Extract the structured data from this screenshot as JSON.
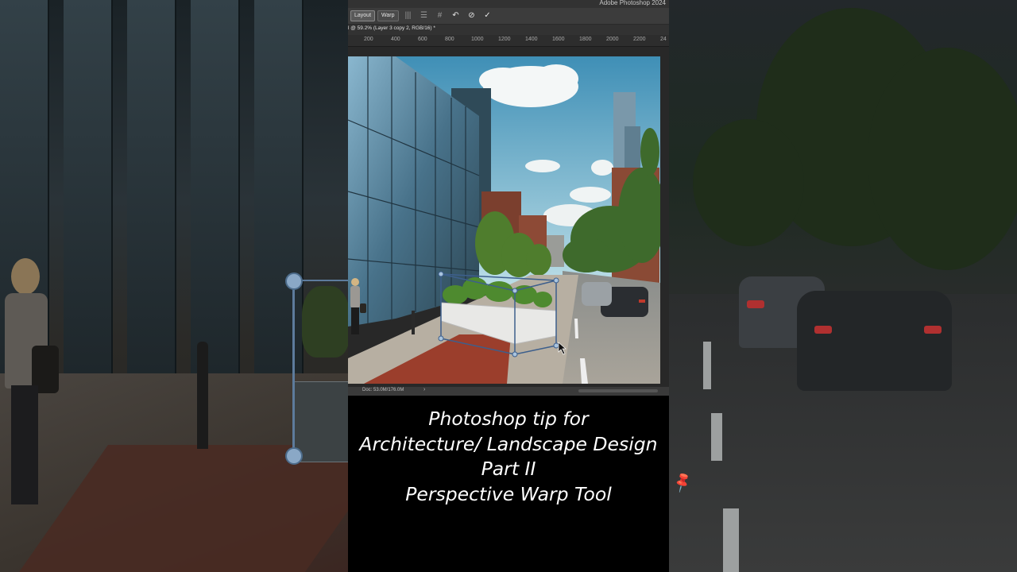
{
  "photoshop": {
    "app_name": "Adobe Photoshop 2024",
    "options_bar": {
      "layout_label": "Layout",
      "warp_label": "Warp",
      "icons": [
        "auto-straighten-vertical-icon",
        "auto-straighten-horizontal-icon",
        "auto-straighten-both-icon",
        "reset-icon",
        "cancel-icon",
        "commit-checkmark-icon"
      ]
    },
    "document_tab": "l @ 59.2% (Layer 3 copy 2, RGB/16) *",
    "ruler_ticks": [
      "200",
      "400",
      "600",
      "800",
      "1000",
      "1200",
      "1400",
      "1600",
      "1800",
      "2000",
      "2200",
      "24"
    ],
    "status_bar": {
      "doc_size": "Doc: 53.0M/176.0M",
      "arrow": "›"
    }
  },
  "caption": {
    "line1": "Photoshop tip for",
    "line2": "Architecture/ Landscape Design",
    "line3": "Part II",
    "line4": "Perspective Warp Tool"
  },
  "colors": {
    "ps_panel": "#3c3c3c",
    "ps_dark": "#282828",
    "warp_grid": "#4d6d96",
    "caption_text": "#ffffff"
  }
}
